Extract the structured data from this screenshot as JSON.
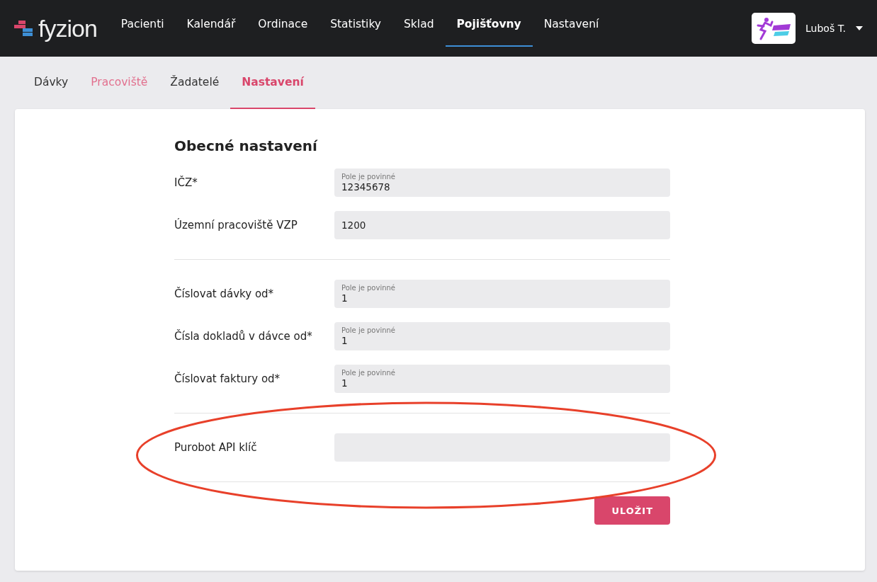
{
  "logo": {
    "text": "fyzion"
  },
  "nav": [
    {
      "label": "Pacienti",
      "selected": false
    },
    {
      "label": "Kalendář",
      "selected": false
    },
    {
      "label": "Ordinace",
      "selected": false
    },
    {
      "label": "Statistiky",
      "selected": false
    },
    {
      "label": "Sklad",
      "selected": false
    },
    {
      "label": "Pojišťovny",
      "selected": true
    },
    {
      "label": "Nastavení",
      "selected": false
    }
  ],
  "user": {
    "name": "Luboš T."
  },
  "subtabs": [
    {
      "label": "Dávky",
      "selected": false,
      "hovered": false
    },
    {
      "label": "Pracoviště",
      "selected": false,
      "hovered": true
    },
    {
      "label": "Žadatelé",
      "selected": false,
      "hovered": false
    },
    {
      "label": "Nastavení",
      "selected": true,
      "hovered": false
    }
  ],
  "form": {
    "title": "Obecné nastavení",
    "sections": [
      {
        "fields": [
          {
            "label": "IČZ*",
            "helper": "Pole je povinné",
            "value": "12345678"
          },
          {
            "label": "Územní pracoviště VZP",
            "value": "1200"
          }
        ]
      },
      {
        "fields": [
          {
            "label": "Číslovat dávky od*",
            "helper": "Pole je povinné",
            "value": "1"
          },
          {
            "label": "Čísla dokladů v dávce od*",
            "helper": "Pole je povinné",
            "value": "1"
          },
          {
            "label": "Číslovat faktury od*",
            "helper": "Pole je povinné",
            "value": "1"
          }
        ]
      },
      {
        "annotation": {
          "kind": "ellipse",
          "color": "#e8402a"
        },
        "fields": [
          {
            "label": "Purobot API klíč"
          }
        ]
      }
    ],
    "save_button": "ULOŽIT"
  }
}
